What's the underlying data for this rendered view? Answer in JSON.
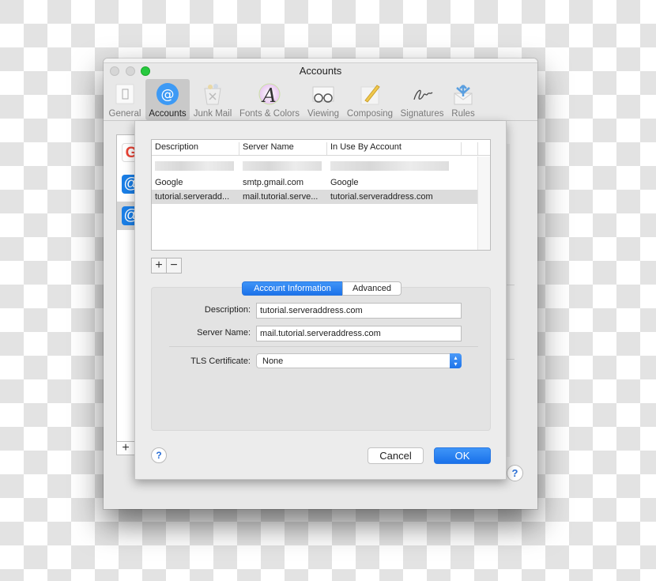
{
  "window": {
    "title": "Accounts",
    "toolbar": [
      {
        "label": "General",
        "icon": "general-switch-icon",
        "active": false
      },
      {
        "label": "Accounts",
        "icon": "at-sign-icon",
        "active": true
      },
      {
        "label": "Junk Mail",
        "icon": "junk-basket-icon",
        "active": false
      },
      {
        "label": "Fonts & Colors",
        "icon": "font-color-wheel-icon",
        "active": false
      },
      {
        "label": "Viewing",
        "icon": "glasses-icon",
        "active": false
      },
      {
        "label": "Composing",
        "icon": "pencil-paper-icon",
        "active": false
      },
      {
        "label": "Signatures",
        "icon": "signature-icon",
        "active": false
      },
      {
        "label": "Rules",
        "icon": "envelope-arrows-icon",
        "active": false
      }
    ]
  },
  "background_accounts": {
    "items": [
      {
        "icon": "google-icon",
        "glyph": "G",
        "selected": false
      },
      {
        "icon": "at-sign-icon",
        "glyph": "@",
        "selected": false
      },
      {
        "icon": "at-sign-icon",
        "glyph": "@",
        "selected": true
      }
    ],
    "add_label": "+",
    "help_label": "?"
  },
  "smtp_sheet": {
    "columns": [
      "Description",
      "Server Name",
      "In Use By Account"
    ],
    "rows": [
      {
        "description": "Google",
        "server": "smtp.gmail.com",
        "account": "Google",
        "selected": false
      },
      {
        "description": "tutorial.serveradd...",
        "server": "mail.tutorial.serve...",
        "account": "tutorial.serveraddress.com",
        "selected": true
      }
    ],
    "add_label": "+",
    "remove_label": "−",
    "tabs": [
      {
        "label": "Account Information",
        "active": true
      },
      {
        "label": "Advanced",
        "active": false
      }
    ],
    "fields": {
      "description_label": "Description:",
      "description_value": "tutorial.serveraddress.com",
      "server_label": "Server Name:",
      "server_value": "mail.tutorial.serveraddress.com",
      "tls_label": "TLS Certificate:",
      "tls_value": "None"
    },
    "help_label": "?",
    "cancel_label": "Cancel",
    "ok_label": "OK"
  }
}
